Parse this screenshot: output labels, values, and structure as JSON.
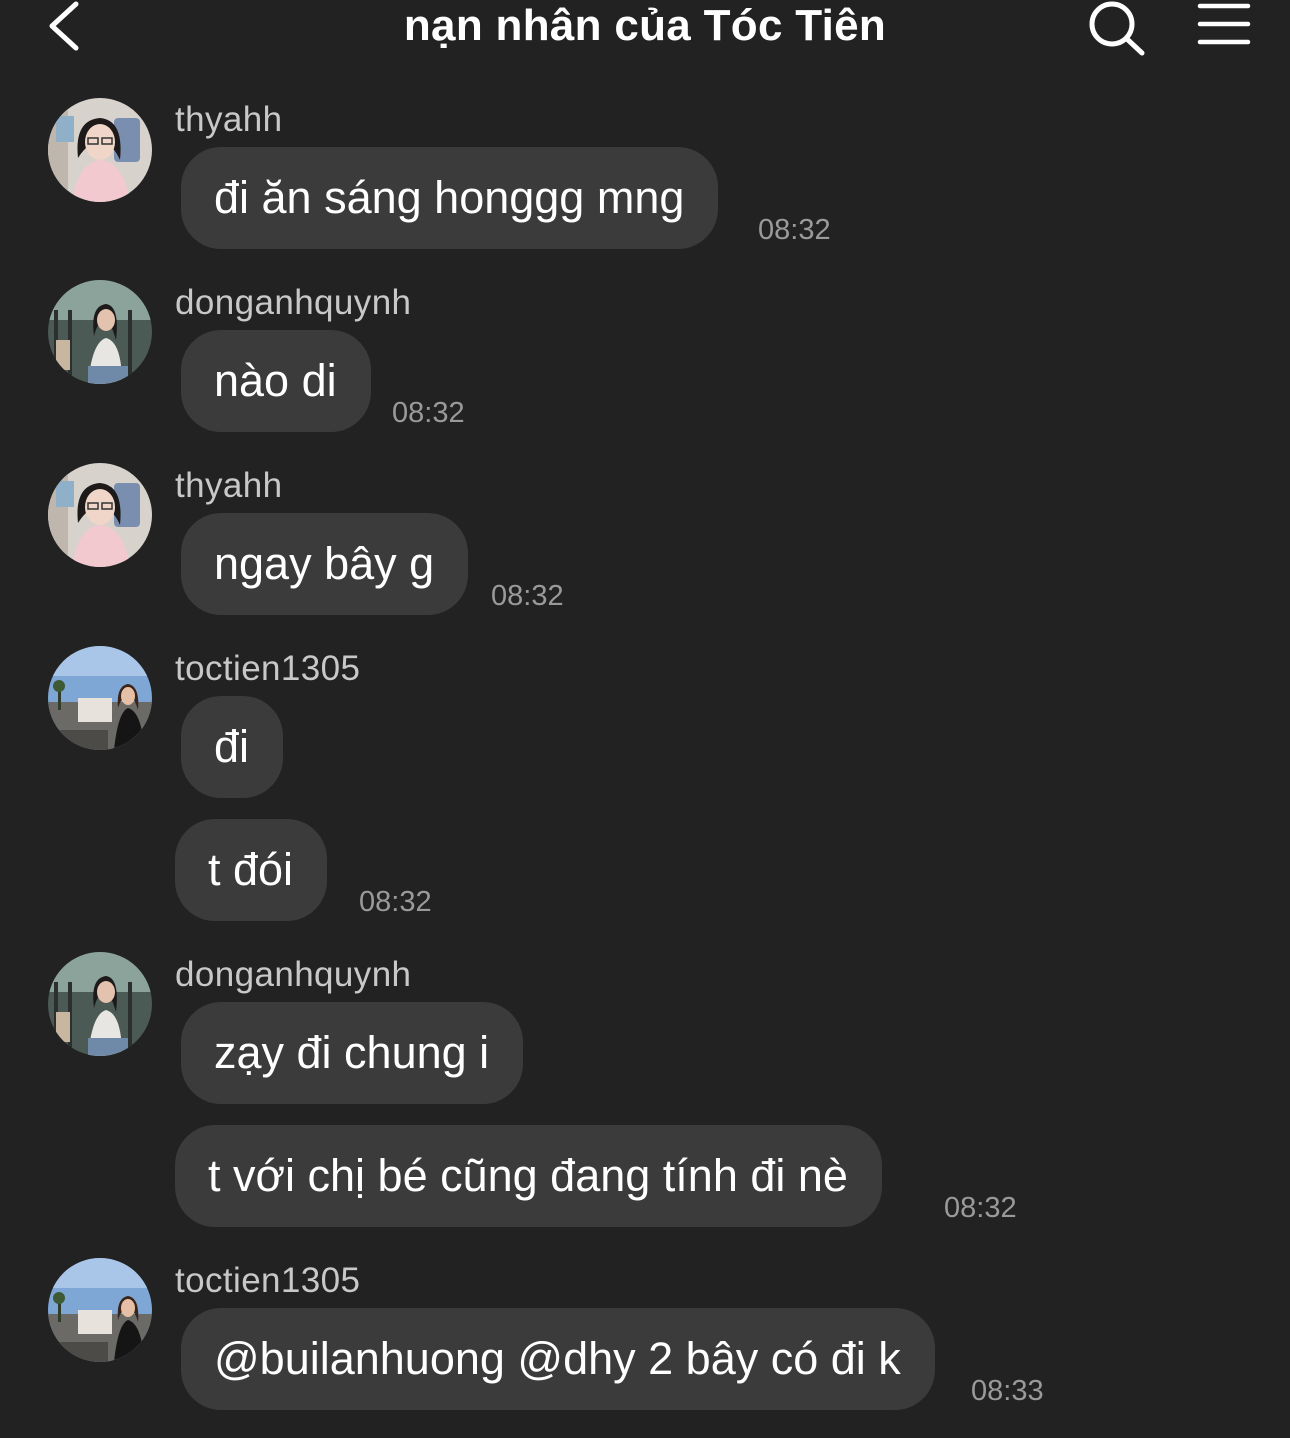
{
  "header": {
    "title": "nạn nhân của Tóc Tiên",
    "back_icon": "chevron-left-icon",
    "search_icon": "search-icon",
    "menu_icon": "hamburger-menu-icon"
  },
  "messages": [
    {
      "user": "thyahh",
      "text": "đi ăn sáng honggg mng",
      "time": "08:32"
    },
    {
      "user": "donganhquynh",
      "text": "nào di",
      "time": "08:32"
    },
    {
      "user": "thyahh",
      "text": "ngay bây g",
      "time": "08:32"
    },
    {
      "user": "toctien1305",
      "text": "đi",
      "time": ""
    },
    {
      "user": "",
      "text": "t đói",
      "time": "08:32"
    },
    {
      "user": "donganhquynh",
      "text": "zạy đi chung i",
      "time": ""
    },
    {
      "user": "",
      "text": "t với chị bé cũng đang tính đi nè",
      "time": "08:32"
    },
    {
      "user": "toctien1305",
      "text": "@builanhuong @dhy 2 bây có đi k",
      "time": "08:33"
    }
  ],
  "colors": {
    "background": "#222222",
    "bubble": "#3b3b3b",
    "username": "#c8c8c8",
    "timestamp": "#9a9a9a",
    "text": "#ffffff"
  }
}
